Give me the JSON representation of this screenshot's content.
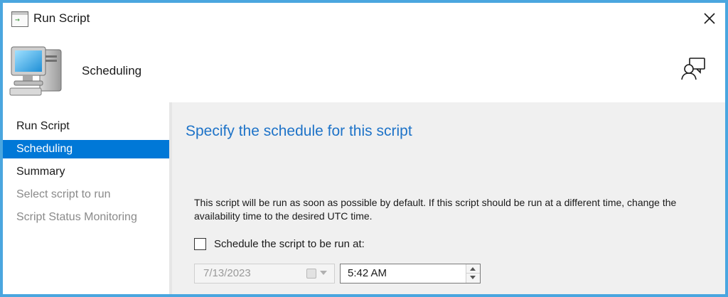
{
  "window": {
    "title": "Run Script"
  },
  "header": {
    "title": "Scheduling"
  },
  "nav": {
    "items": [
      {
        "label": "Run Script",
        "state": "normal"
      },
      {
        "label": "Scheduling",
        "state": "selected"
      },
      {
        "label": "Summary",
        "state": "normal"
      },
      {
        "label": "Select script to run",
        "state": "disabled"
      },
      {
        "label": "Script Status Monitoring",
        "state": "disabled"
      }
    ]
  },
  "main": {
    "title": "Specify the schedule for this script",
    "info": "This script will be run as soon as possible by default. If this script should be run at a different time, change the availability time to the desired UTC time.",
    "schedule_checkbox": {
      "label": "Schedule the script to be run at:",
      "checked": false
    },
    "date_value": "7/13/2023",
    "time_value": "5:42 AM"
  },
  "colors": {
    "accent": "#0078d7",
    "title_blue": "#1e73c8",
    "window_border": "#4aa6df",
    "content_bg": "#f0f0f0"
  },
  "icons": [
    "run-script-icon",
    "close-icon",
    "computer-icon",
    "help-icon",
    "calendar-icon",
    "dropdown-arrow-icon",
    "spin-up-icon",
    "spin-down-icon"
  ]
}
